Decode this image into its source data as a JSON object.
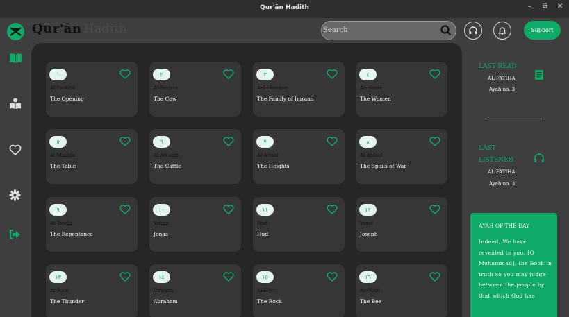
{
  "window": {
    "title": "Qur'ān Hadith",
    "controls": [
      "–",
      "⧉",
      "✕"
    ]
  },
  "header": {
    "brand": "Qur'ān",
    "brand_faded": "Hadith",
    "search_placeholder": "Search",
    "support_label": "Support"
  },
  "sidebar": {
    "items": [
      {
        "name": "quran",
        "icon": "open-book-icon"
      },
      {
        "name": "hadith",
        "icon": "reading-icon"
      },
      {
        "name": "favorites",
        "icon": "heart-icon"
      },
      {
        "name": "settings",
        "icon": "gear-icon"
      },
      {
        "name": "logout",
        "icon": "logout-icon"
      }
    ]
  },
  "surahs": [
    {
      "num": "١",
      "arabic": "Al-Faatiha",
      "english": "The Opening"
    },
    {
      "num": "٢",
      "arabic": "Al-Baqara",
      "english": "The Cow"
    },
    {
      "num": "٣",
      "arabic": "Aal-i-Imraan",
      "english": "The Family of Imraan"
    },
    {
      "num": "٤",
      "arabic": "An-Nisaa",
      "english": "The Women"
    },
    {
      "num": "٥",
      "arabic": "Al-Maaida",
      "english": "The Table"
    },
    {
      "num": "٦",
      "arabic": "Al-An'aam",
      "english": "The Cattle"
    },
    {
      "num": "٧",
      "arabic": "Al-A'raaf",
      "english": "The Heights"
    },
    {
      "num": "٨",
      "arabic": "Al-Anfaal",
      "english": "The Spoils of War"
    },
    {
      "num": "٩",
      "arabic": "At-Tawba",
      "english": "The Repentance"
    },
    {
      "num": "١٠",
      "arabic": "Yunus",
      "english": "Jonas"
    },
    {
      "num": "١١",
      "arabic": "Hud",
      "english": "Hud"
    },
    {
      "num": "١٢",
      "arabic": "Yusuf",
      "english": "Joseph"
    },
    {
      "num": "١٣",
      "arabic": "Ar-Ra'd",
      "english": "The Thunder"
    },
    {
      "num": "١٤",
      "arabic": "Ibrahim",
      "english": "Abraham"
    },
    {
      "num": "١٥",
      "arabic": "Al-Hijr",
      "english": "The Rock"
    },
    {
      "num": "١٦",
      "arabic": "An-Nahl",
      "english": "The Bee"
    }
  ],
  "last_read": {
    "title": "LAST READ",
    "surah": "AL FATIHA",
    "ayah": "Ayah no. 3"
  },
  "last_listened": {
    "title_line1": "LAST",
    "title_line2": "LISTENED",
    "surah": "AL FATIHA",
    "ayah": "Ayah no. 3"
  },
  "ayah_of_day": {
    "title": "AYAH OF THE DAY",
    "text": "Indeed, We have revealed to you, [O Muhammad], the Book in truth so you may judge between the people by that which God has"
  },
  "colors": {
    "accent": "#0fa968",
    "background": "#3e3e3e",
    "main_panel": "#262626",
    "card": "#363636"
  }
}
